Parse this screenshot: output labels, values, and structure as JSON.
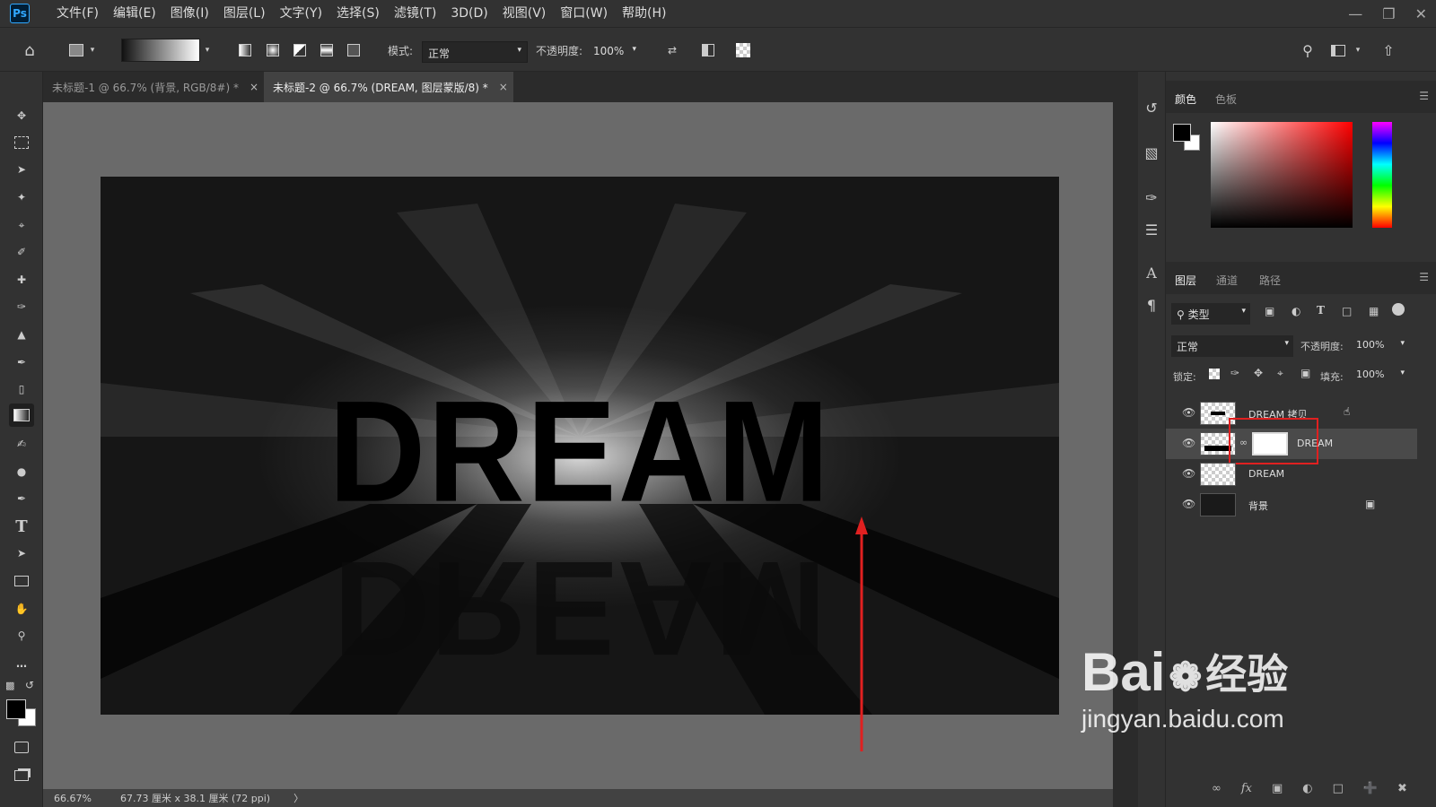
{
  "app": {
    "logo": "Ps"
  },
  "menu": [
    "文件(F)",
    "编辑(E)",
    "图像(I)",
    "图层(L)",
    "文字(Y)",
    "选择(S)",
    "滤镜(T)",
    "3D(D)",
    "视图(V)",
    "窗口(W)",
    "帮助(H)"
  ],
  "options": {
    "mode_label": "模式:",
    "mode_value": "正常",
    "opacity_label": "不透明度:",
    "opacity_value": "100%"
  },
  "tabs": [
    {
      "label": "未标题-1 @ 66.7% (背景, RGB/8#) *",
      "close": "×"
    },
    {
      "label": "未标题-2 @ 66.7% (DREAM, 图层蒙版/8) *",
      "close": "×"
    }
  ],
  "canvas": {
    "text": "DREAM",
    "reflection": "DREAM"
  },
  "status": {
    "zoom": "66.67%",
    "doc_size": "67.73 厘米 x 38.1 厘米 (72 ppi)",
    "arrow": "〉"
  },
  "color_panel": {
    "tabs": [
      "颜色",
      "色板"
    ]
  },
  "layers_panel": {
    "tabs": [
      "图层",
      "通道",
      "路径"
    ],
    "filter_label": "类型",
    "blend_mode": "正常",
    "opacity_label": "不透明度:",
    "opacity_value": "100%",
    "lock_label": "锁定:",
    "fill_label": "填充:",
    "fill_value": "100%",
    "layers": [
      {
        "name": "DREAM 拷贝"
      },
      {
        "name": "DREAM"
      },
      {
        "name": "DREAM"
      },
      {
        "name": "背景"
      }
    ]
  },
  "watermark": {
    "brand": "Bai",
    "brand2": "经验",
    "url": "jingyan.baidu.com"
  },
  "colors": {
    "highlight": "#e02020",
    "accent": "#31a8ff"
  }
}
